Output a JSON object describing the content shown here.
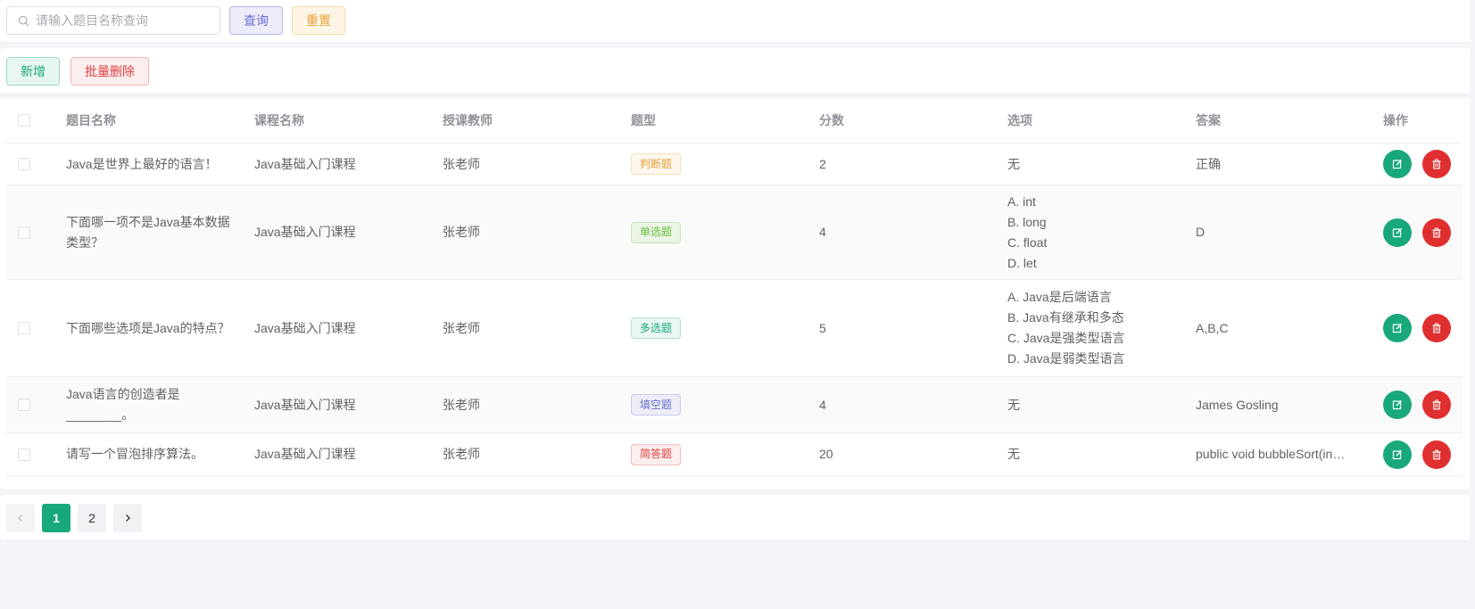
{
  "search": {
    "placeholder": "请输入题目名称查询"
  },
  "toolbar": {
    "query_label": "查询",
    "reset_label": "重置",
    "add_label": "新增",
    "batch_delete_label": "批量删除"
  },
  "table": {
    "headers": {
      "title": "题目名称",
      "course": "课程名称",
      "teacher": "授课教师",
      "type": "题型",
      "score": "分数",
      "options": "选项",
      "answer": "答案",
      "actions": "操作"
    },
    "rows": [
      {
        "title": [
          "Java是世界上最好的语言！"
        ],
        "course": "Java基础入门课程",
        "teacher": "张老师",
        "type": "判断题",
        "type_color": "#e6a23c",
        "score": "2",
        "options": [
          "无"
        ],
        "answer": "正确"
      },
      {
        "title": [
          "下面哪一项不是Java基本数据",
          "类型？"
        ],
        "course": "Java基础入门课程",
        "teacher": "张老师",
        "type": "单选题",
        "type_color": "#67c23a",
        "score": "4",
        "options": [
          "A. int",
          "B. long",
          "C. float",
          "D. let"
        ],
        "answer": "D"
      },
      {
        "title": [
          "下面哪些选项是Java的特点？"
        ],
        "course": "Java基础入门课程",
        "teacher": "张老师",
        "type": "多选题",
        "type_color": "#19a87c",
        "score": "5",
        "options": [
          "A. Java是后端语言",
          "B. Java有继承和多态",
          "C. Java是强类型语言",
          "D. Java是弱类型语言"
        ],
        "answer": "A,B,C"
      },
      {
        "title": [
          "Java语言的创造者是",
          "________。"
        ],
        "course": "Java基础入门课程",
        "teacher": "张老师",
        "type": "填空题",
        "type_color": "#6c6cd8",
        "score": "4",
        "options": [
          "无"
        ],
        "answer": "James Gosling"
      },
      {
        "title": [
          "请写一个冒泡排序算法。"
        ],
        "course": "Java基础入门课程",
        "teacher": "张老师",
        "type": "简答题",
        "type_color": "#e03e3e",
        "score": "20",
        "options": [
          "无"
        ],
        "answer": "public void bubbleSort(in…"
      }
    ]
  },
  "pagination": {
    "pages": [
      "1",
      "2"
    ],
    "current": "1"
  },
  "icons": {
    "search": "search-icon",
    "edit": "edit-icon",
    "delete": "trash-icon",
    "prev": "chevron-left-icon",
    "next": "chevron-right-icon"
  },
  "colors": {
    "primary": "#19a87c",
    "danger": "#e02f2f",
    "background": "#f4f4f9"
  }
}
